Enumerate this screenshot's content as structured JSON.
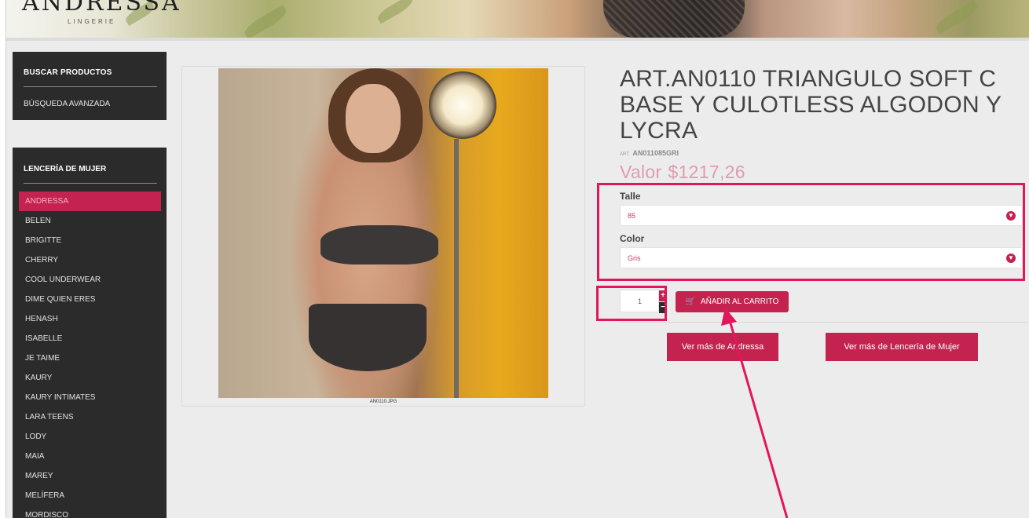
{
  "header": {
    "logo_text": "ANDRESSA",
    "logo_sub": "LINGERIE"
  },
  "sidebar": {
    "search": {
      "title": "BUSCAR PRODUCTOS",
      "link": "BÚSQUEDA AVANZADA"
    },
    "category": {
      "title": "LENCERÍA DE MUJER",
      "items": [
        {
          "label": "ANDRESSA",
          "active": true
        },
        {
          "label": "BELEN"
        },
        {
          "label": "BRIGITTE"
        },
        {
          "label": "CHERRY"
        },
        {
          "label": "COOL UNDERWEAR"
        },
        {
          "label": "DIME QUIEN ERES"
        },
        {
          "label": "HENASH"
        },
        {
          "label": "ISABELLE"
        },
        {
          "label": "JE TAIME"
        },
        {
          "label": "KAURY"
        },
        {
          "label": "KAURY INTIMATES"
        },
        {
          "label": "LARA TEENS"
        },
        {
          "label": "LODY"
        },
        {
          "label": "MAIA"
        },
        {
          "label": "MAREY"
        },
        {
          "label": "MELÍFERA"
        },
        {
          "label": "MORDISCO"
        }
      ]
    }
  },
  "product": {
    "image_caption": "AN0110.JPG",
    "title": "ART.AN0110 TRIANGULO SOFT C BASE Y CULOTLESS ALGODON Y LYCRA",
    "sku_label": "ART",
    "sku": "AN011085GRI",
    "price_label": "Valor",
    "price": "$1217,26",
    "size_label": "Talle",
    "size_value": "85",
    "color_label": "Color",
    "color_value": "Gris",
    "quantity": "1",
    "qty_plus": "+",
    "qty_minus": "−",
    "add_to_cart": "AÑADIR AL CARRITO",
    "more_brand": "Ver más de Andressa",
    "more_category": "Ver más de Lencería de Mujer"
  },
  "colors": {
    "accent": "#c4234f",
    "annotation": "#e2165d",
    "sidebar_bg": "#2b2b2b"
  },
  "icons": {
    "cart": "cart-icon",
    "select_arrow": "chevron-down-icon"
  }
}
